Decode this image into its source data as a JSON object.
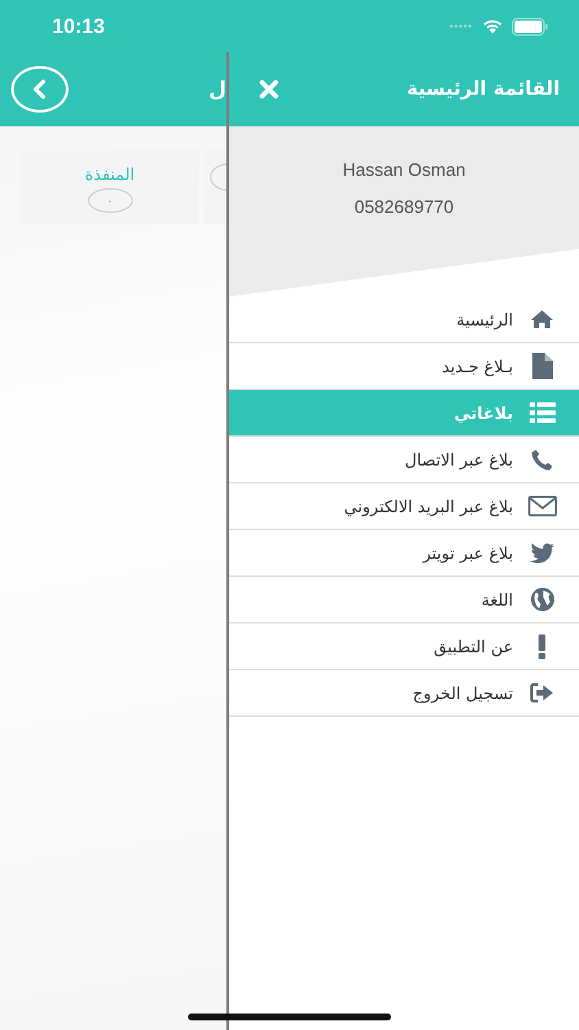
{
  "status_bar": {
    "time": "10:13"
  },
  "background_screen": {
    "title": "ل",
    "cards": [
      {
        "label": "المنفذة",
        "count": "٠"
      }
    ]
  },
  "drawer": {
    "title": "القائمة الرئيسية",
    "user": {
      "name": "Hassan Osman",
      "phone": "0582689770"
    },
    "items": [
      {
        "label": "الرئيسية",
        "selected": false
      },
      {
        "label": "بـلاغ جـديد",
        "selected": false
      },
      {
        "label": "بلاغاتي",
        "selected": true
      },
      {
        "label": "بلاغ عبر الاتصال",
        "selected": false
      },
      {
        "label": "بلاغ عبر البريد الالكتروني",
        "selected": false
      },
      {
        "label": "بلاغ عبر تويتر",
        "selected": false
      },
      {
        "label": "اللغة",
        "selected": false
      },
      {
        "label": "عن التطبيق",
        "selected": false
      },
      {
        "label": "تسجيل الخروج",
        "selected": false
      }
    ]
  }
}
